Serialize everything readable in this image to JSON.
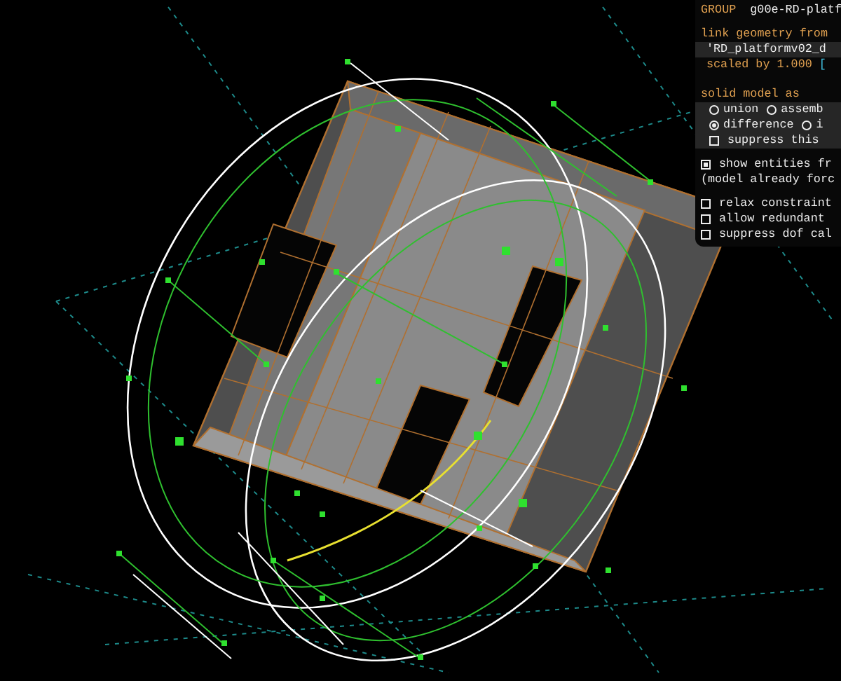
{
  "group_panel": {
    "header_label": "GROUP",
    "group_name": "g00e-RD-platf",
    "link_label": "link geometry from",
    "linked_file": "'RD_platformv02_d",
    "scale_label": "scaled by 1.000",
    "scale_link": "[",
    "solid_label": "solid model as",
    "solid_options": [
      {
        "label": "union",
        "selected": false
      },
      {
        "label": "assemb",
        "selected": false
      },
      {
        "label": "difference",
        "selected": true
      },
      {
        "label": "i",
        "selected": false
      }
    ],
    "suppress": {
      "label": "suppress this",
      "checked": false
    },
    "show_entities": {
      "label": "show entities fr",
      "checked": true
    },
    "note": "(model already forc",
    "options": [
      {
        "label": "relax constraint",
        "checked": false
      },
      {
        "label": "allow redundant",
        "checked": false
      },
      {
        "label": "suppress dof cal",
        "checked": false
      }
    ]
  }
}
